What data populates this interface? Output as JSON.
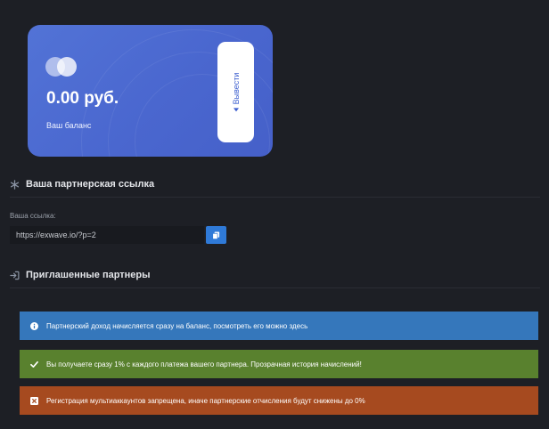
{
  "balance": {
    "amount": "0.00 руб.",
    "label": "Ваш баланс",
    "withdraw_label": "Вывести"
  },
  "referral": {
    "heading": "Ваша партнерская ссылка",
    "link_label": "Ваша ссылка:",
    "link_value": "https://exwave.io/?p=2"
  },
  "partners": {
    "heading": "Приглашенные партнеры"
  },
  "alerts": [
    {
      "type": "info",
      "text": "Партнерский доход начисляется сразу на баланс, посмотреть его можно здесь"
    },
    {
      "type": "success",
      "text": "Вы получаете сразу 1% с каждого платежа вашего партнера. Прозрачная история начислений!"
    },
    {
      "type": "danger",
      "text": "Регистрация мультиаккаунтов запрещена, иначе партнерские отчисления будут снижены до 0%"
    }
  ],
  "colors": {
    "card": "#4d6ad2",
    "info": "#3577bb",
    "success": "#59812e",
    "danger": "#a64a1f",
    "copy_button": "#2f7ad8"
  }
}
